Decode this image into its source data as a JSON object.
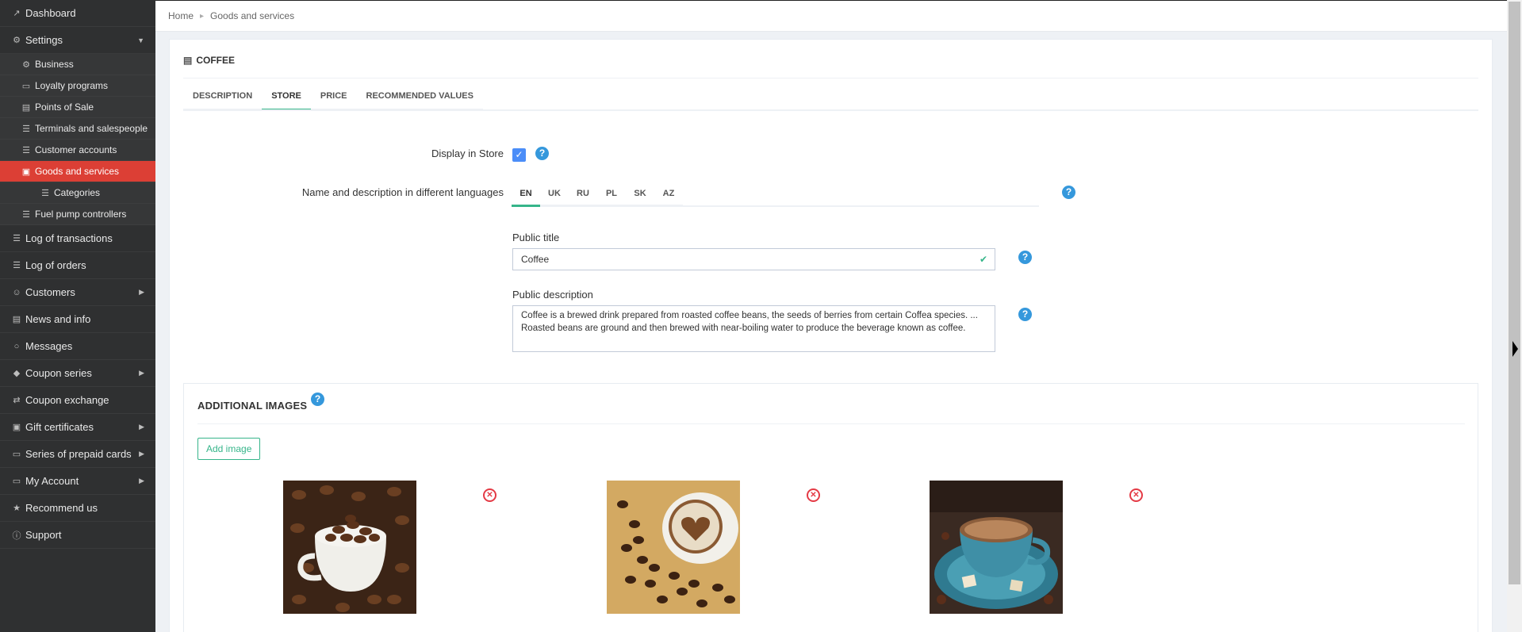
{
  "breadcrumb": {
    "home": "Home",
    "current": "Goods and services"
  },
  "sidebar": {
    "items": [
      {
        "label": "Dashboard",
        "icon": "chart-icon"
      },
      {
        "label": "Settings",
        "icon": "gear-icon",
        "expanded": true
      },
      {
        "label": "Business",
        "icon": "gear-icon"
      },
      {
        "label": "Loyalty programs",
        "icon": "card-icon"
      },
      {
        "label": "Points of Sale",
        "icon": "building-icon"
      },
      {
        "label": "Terminals and salespeople",
        "icon": "cart-icon"
      },
      {
        "label": "Customer accounts",
        "icon": "list-icon"
      },
      {
        "label": "Goods and services",
        "icon": "box-icon",
        "active": true
      },
      {
        "label": "Categories",
        "icon": "list-icon"
      },
      {
        "label": "Fuel pump controllers",
        "icon": "list-icon"
      },
      {
        "label": "Log of transactions",
        "icon": "list-icon"
      },
      {
        "label": "Log of orders",
        "icon": "list-icon"
      },
      {
        "label": "Customers",
        "icon": "users-icon"
      },
      {
        "label": "News and info",
        "icon": "newspaper-icon"
      },
      {
        "label": "Messages",
        "icon": "comment-icon"
      },
      {
        "label": "Coupon series",
        "icon": "tag-icon"
      },
      {
        "label": "Coupon exchange",
        "icon": "exchange-icon"
      },
      {
        "label": "Gift certificates",
        "icon": "gift-icon"
      },
      {
        "label": "Series of prepaid cards",
        "icon": "money-icon"
      },
      {
        "label": "My Account",
        "icon": "account-icon"
      },
      {
        "label": "Recommend us",
        "icon": "star-icon"
      },
      {
        "label": "Support",
        "icon": "question-icon"
      }
    ]
  },
  "panel": {
    "title": "COFFEE",
    "tabs": [
      "DESCRIPTION",
      "STORE",
      "PRICE",
      "RECOMMENDED VALUES"
    ],
    "active_tab": "STORE"
  },
  "store": {
    "display_label": "Display in Store",
    "display_checked": true,
    "names_label": "Name and description in different languages",
    "languages": [
      "EN",
      "UK",
      "RU",
      "PL",
      "SK",
      "AZ"
    ],
    "active_language": "EN",
    "public_title_label": "Public title",
    "public_title_value": "Coffee",
    "public_description_label": "Public description",
    "public_description_value": "Coffee is a brewed drink prepared from roasted coffee beans, the seeds of berries from certain Coffea species. ... Roasted beans are ground and then brewed with near-boiling water to produce the beverage known as coffee."
  },
  "images": {
    "title": "ADDITIONAL IMAGES",
    "add_button": "Add image",
    "items": [
      {
        "subject": "coffee beans in cup"
      },
      {
        "subject": "latte art heart"
      },
      {
        "subject": "coffee cup with star anise"
      }
    ]
  },
  "colors": {
    "accent": "#36b58a",
    "active_menu": "#dc3f35",
    "help": "#3598dc",
    "remove": "#e43a45"
  }
}
